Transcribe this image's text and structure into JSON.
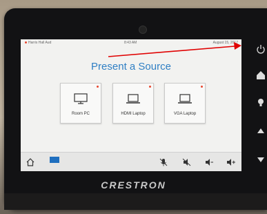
{
  "status": {
    "location": "Harris Hall Aud",
    "time": "8:43 AM",
    "date": "August 15, 2017"
  },
  "main": {
    "title": "Present a Source"
  },
  "sources": [
    {
      "label": "Room PC"
    },
    {
      "label": "HDMI Laptop"
    },
    {
      "label": "VGA Laptop"
    }
  ],
  "brand": "CRESTRON",
  "colors": {
    "accent": "#2f7fc4",
    "indicator": "#e8472f",
    "selected": "#1f6fbf",
    "annotation_arrow": "#e00000"
  },
  "bottom_bar_icons": [
    "home-icon",
    "screen-icon",
    "mic-mute-icon",
    "volume-mute-icon",
    "volume-down-icon",
    "volume-up-icon"
  ],
  "side_buttons": [
    "power-icon",
    "home-icon",
    "light-icon",
    "up-arrow-icon",
    "down-arrow-icon"
  ]
}
